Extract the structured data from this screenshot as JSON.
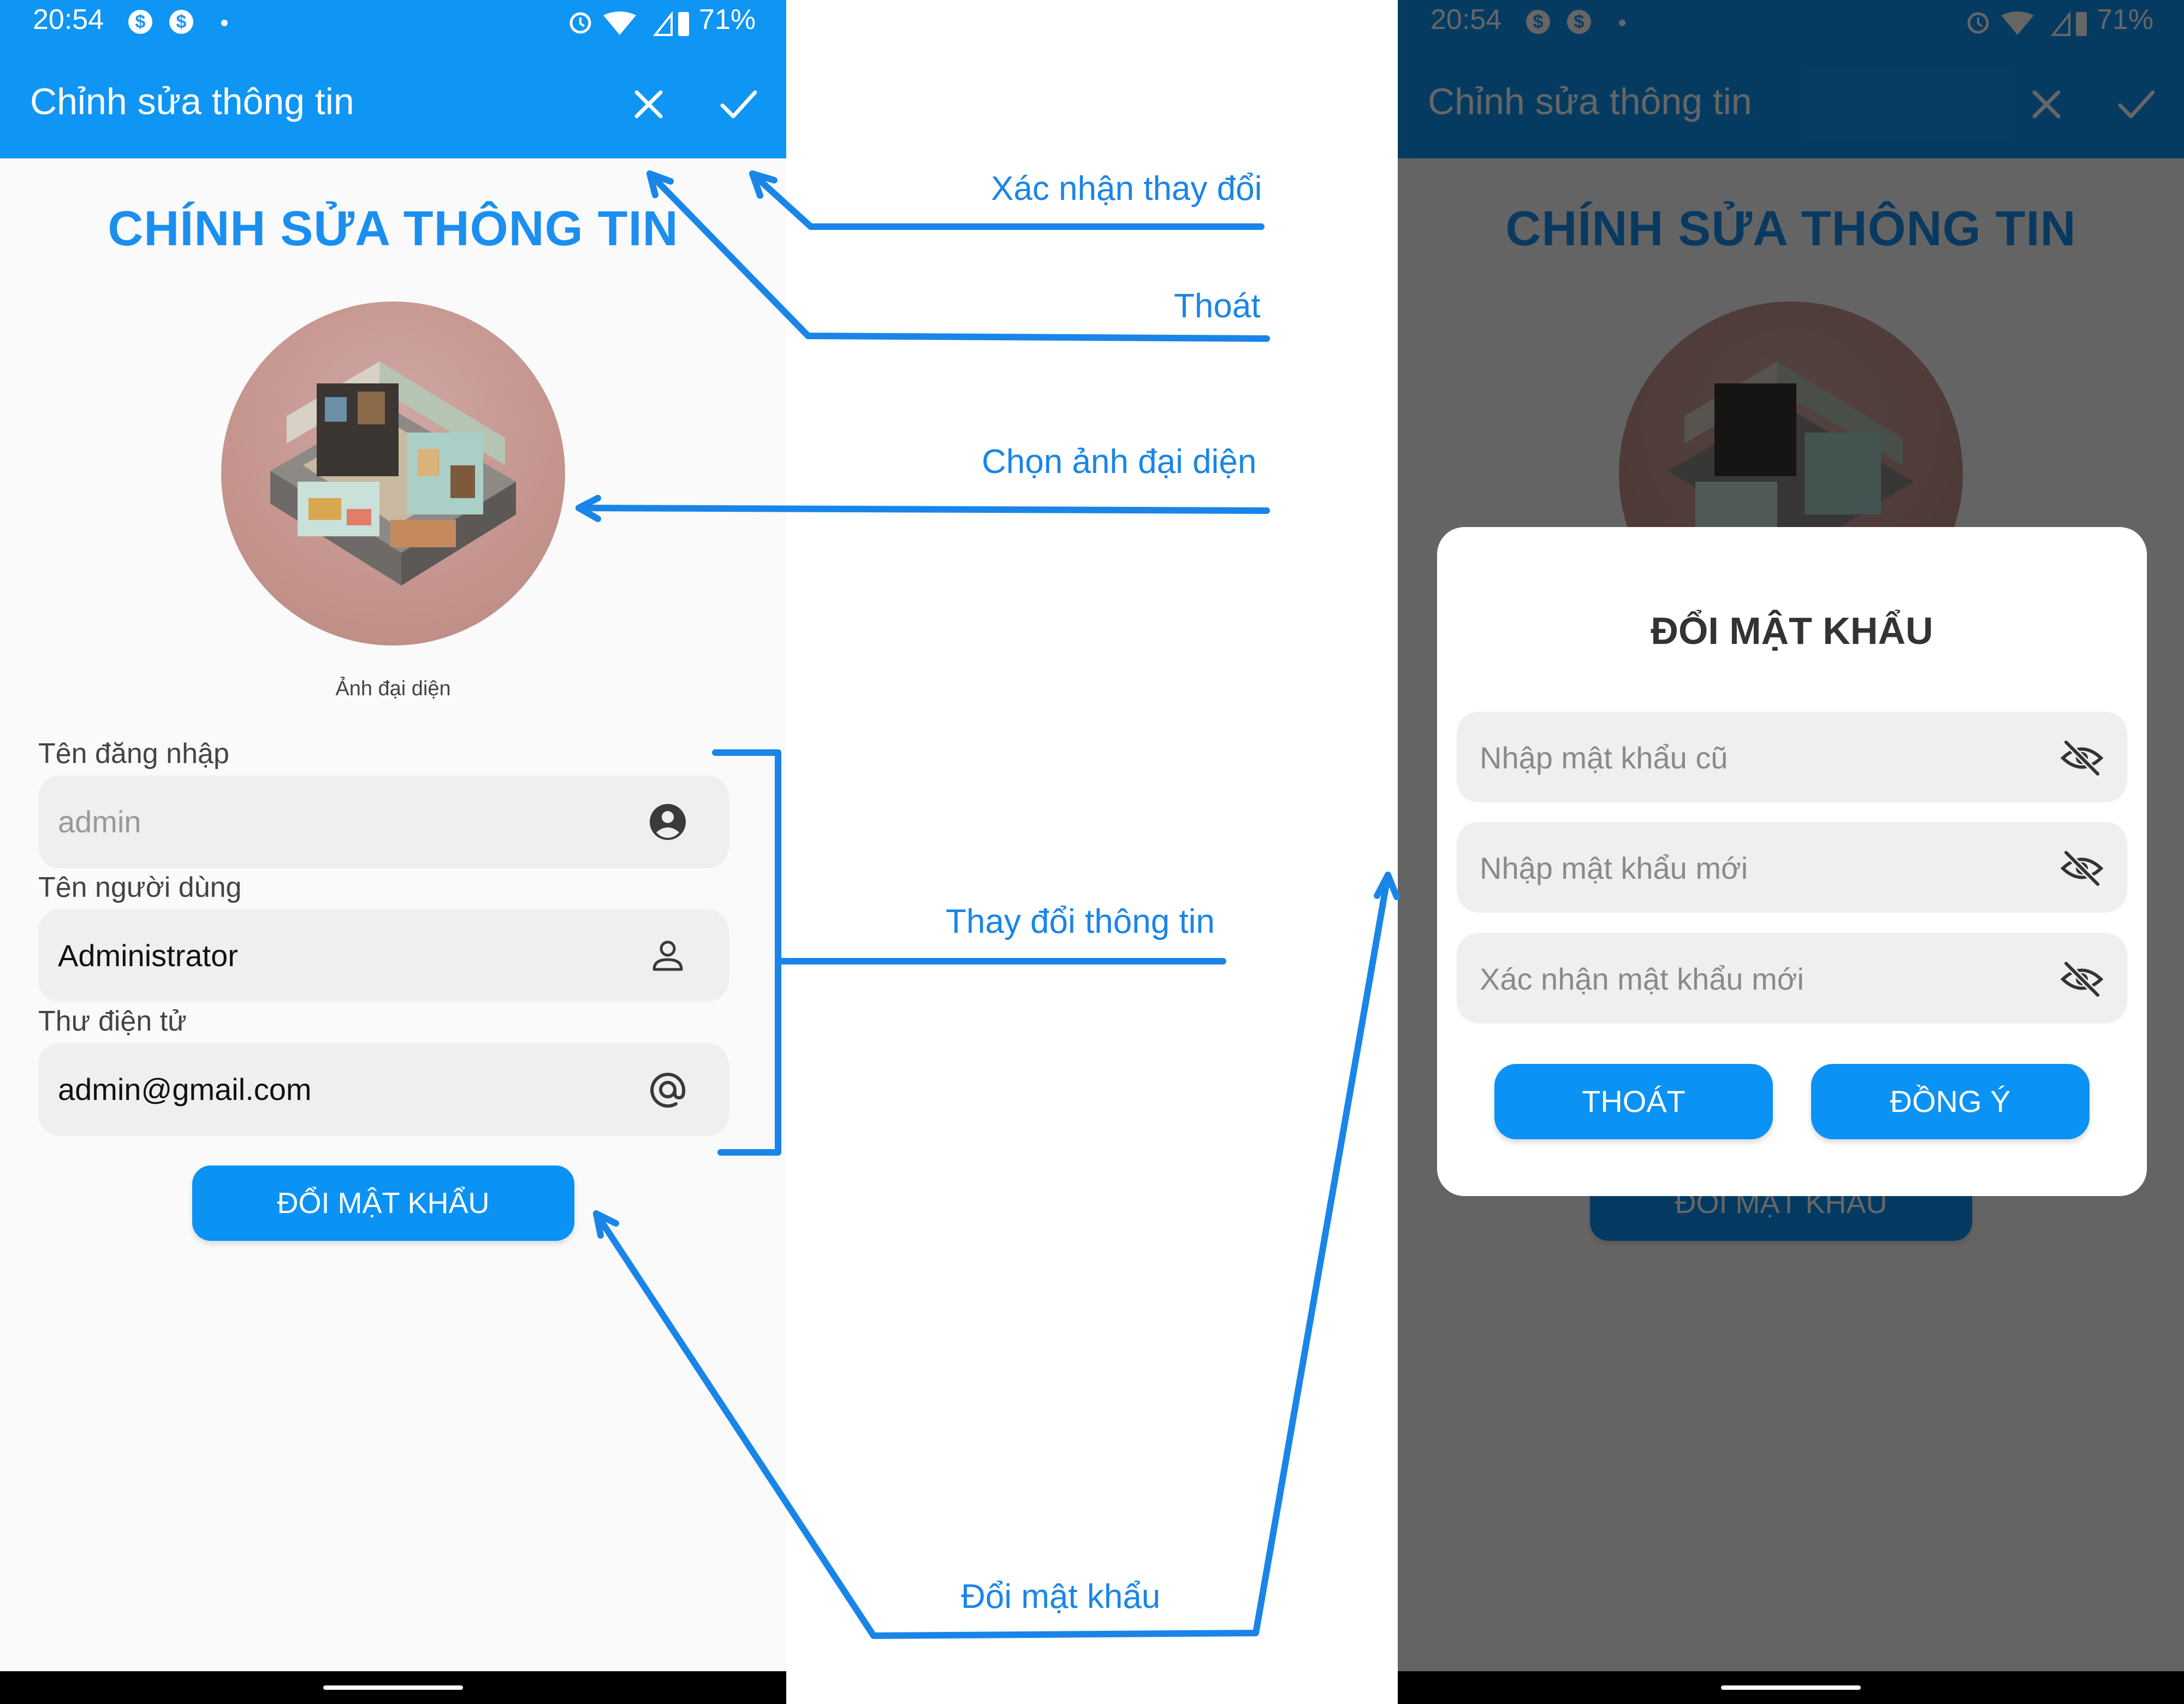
{
  "status_bar": {
    "time": "20:54",
    "battery": "71%"
  },
  "app_bar": {
    "title": "Chỉnh sửa thông tin"
  },
  "edit_screen": {
    "heading": "CHÍNH SỬA THÔNG TIN",
    "avatar_caption": "Ảnh đại diện",
    "fields": [
      {
        "label": "Tên đăng nhập",
        "value": "admin",
        "icon": "account-circle-icon"
      },
      {
        "label": "Tên người dùng",
        "value": "Administrator",
        "icon": "person-outline-icon"
      },
      {
        "label": "Thư điện tử",
        "value": "admin@gmail.com",
        "icon": "at-sign-icon"
      }
    ],
    "change_password_button": "ĐỔI MẬT KHẨU"
  },
  "password_dialog": {
    "title": "ĐỔI MẬT KHẨU",
    "fields": [
      {
        "placeholder": "Nhập mật khẩu cũ",
        "icon": "eye-off-icon"
      },
      {
        "placeholder": "Nhập mật khẩu mới",
        "icon": "eye-off-icon"
      },
      {
        "placeholder": "Xác nhận mật khẩu mới",
        "icon": "eye-off-icon"
      }
    ],
    "cancel_button": "THOÁT",
    "confirm_button": "ĐỒNG Ý"
  },
  "annotations": {
    "confirm": "Xác nhận thay đổi",
    "exit": "Thoát",
    "choose_avatar": "Chọn ảnh đại diện",
    "edit_info": "Thay đổi thông tin",
    "change_password": "Đổi mật khẩu"
  },
  "colors": {
    "primary": "#0f95f3",
    "heading": "#1b8ff0",
    "annotation": "#1a85e8",
    "field_bg": "#efefef"
  }
}
